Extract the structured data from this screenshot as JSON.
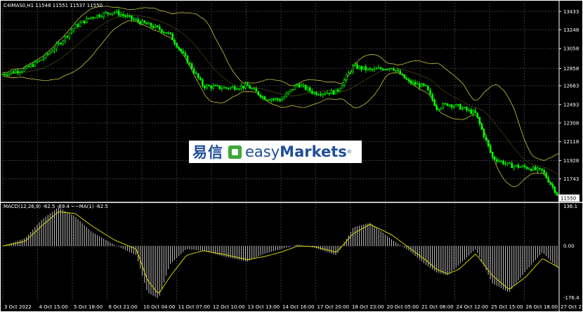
{
  "chart_header": "C4IMAS0,H1  11548 11551 11537 11550",
  "macd_header": "MACD(12,26,9) -62.5 -69.4 ~~MA(1) -62.5",
  "colors": {
    "background": "#000000",
    "candle": "#00ff00",
    "bands": "#c8c83c",
    "grid": "#3a3a3a",
    "signal": "#e6e600",
    "histogram": "#d8d8d8"
  },
  "logo": {
    "cn": "易信",
    "easy": "easy",
    "markets": "Markets",
    "reg": "®"
  },
  "chart_data": [
    {
      "type": "line",
      "title": "",
      "y_ticks": [
        "13433",
        "13248",
        "13058",
        "12858",
        "12683",
        "12493",
        "12308",
        "12118",
        "11928",
        "11743"
      ],
      "ylim": [
        11520,
        13520
      ],
      "last_price": "11550",
      "x_ticks": [
        "3 Oct 2022",
        "4 Oct 15:00",
        "5 Oct 18:00",
        "6 Oct 21:00",
        "10 Oct 04:00",
        "11 Oct 07:00",
        "12 Oct 10:00",
        "13 Oct 13:00",
        "14 Oct 16:00",
        "17 Oct 20:00",
        "18 Oct 23:00",
        "20 Oct 05:00",
        "21 Oct 08:00",
        "24 Oct 12:00",
        "25 Oct 15:00",
        "26 Oct 18:00",
        "27 Oct 21:00"
      ],
      "x": [
        0,
        0.04,
        0.07,
        0.1,
        0.13,
        0.16,
        0.2,
        0.24,
        0.26,
        0.28,
        0.3,
        0.33,
        0.36,
        0.4,
        0.44,
        0.47,
        0.5,
        0.53,
        0.56,
        0.6,
        0.63,
        0.66,
        0.7,
        0.73,
        0.76,
        0.78,
        0.8,
        0.82,
        0.85,
        0.88,
        0.91,
        0.94,
        0.97,
        1
      ],
      "series": [
        {
          "values": [
            12800,
            12850,
            12950,
            13100,
            13280,
            13380,
            13430,
            13340,
            13300,
            13260,
            13200,
            12950,
            12680,
            12660,
            12680,
            12560,
            12540,
            12700,
            12610,
            12620,
            12880,
            12840,
            12870,
            12720,
            12670,
            12460,
            12500,
            12470,
            12400,
            11960,
            11880,
            11860,
            11820,
            11560
          ]
        }
      ]
    },
    {
      "type": "bar",
      "title": "",
      "y_ticks": [
        "136.1",
        "0.00",
        "-176.4"
      ],
      "ylim": [
        -176.4,
        136.1
      ],
      "x": [
        0,
        0.04,
        0.07,
        0.1,
        0.13,
        0.16,
        0.2,
        0.24,
        0.26,
        0.28,
        0.3,
        0.33,
        0.36,
        0.4,
        0.44,
        0.47,
        0.5,
        0.53,
        0.56,
        0.6,
        0.63,
        0.66,
        0.7,
        0.73,
        0.76,
        0.78,
        0.8,
        0.82,
        0.85,
        0.88,
        0.91,
        0.94,
        0.97,
        1
      ],
      "series": [
        {
          "values": [
            0,
            25,
            85,
            125,
            95,
            45,
            5,
            -30,
            -150,
            -170,
            -60,
            -10,
            -15,
            -35,
            -50,
            -25,
            -10,
            5,
            -5,
            -30,
            60,
            75,
            20,
            -15,
            -60,
            -85,
            -95,
            -60,
            -10,
            -120,
            -150,
            -80,
            -20,
            -75
          ]
        },
        {
          "values": [
            0,
            15,
            65,
            110,
            105,
            65,
            20,
            -10,
            -110,
            -155,
            -100,
            -30,
            -15,
            -28,
            -44,
            -34,
            -20,
            0,
            -2,
            -20,
            40,
            70,
            35,
            -5,
            -45,
            -75,
            -90,
            -75,
            -25,
            -95,
            -140,
            -100,
            -40,
            -70
          ]
        }
      ]
    }
  ]
}
